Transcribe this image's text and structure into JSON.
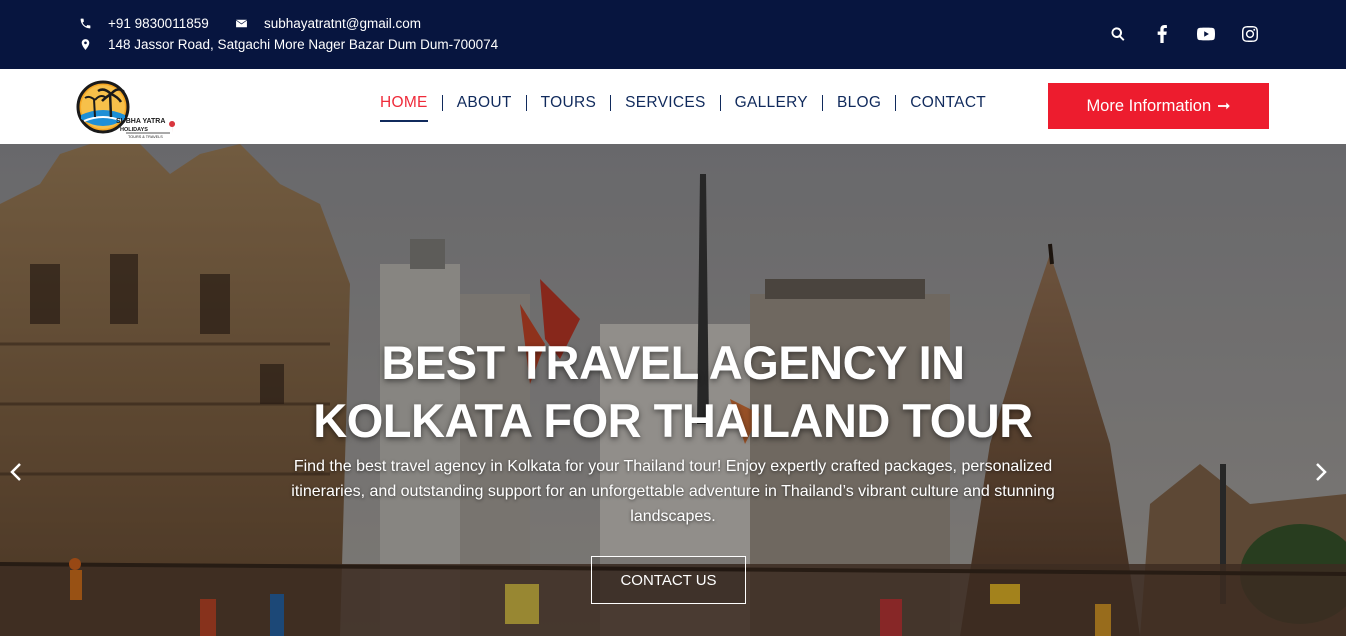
{
  "topbar": {
    "phone": "+91 9830011859",
    "email": "subhayatratnt@gmail.com",
    "address": "148 Jassor Road, Satgachi More Nager Bazar Dum Dum-700074",
    "icons": [
      "phone-icon",
      "envelope-icon",
      "map-marker-icon"
    ],
    "social": [
      "search-icon",
      "facebook-icon",
      "youtube-icon",
      "instagram-icon"
    ]
  },
  "header": {
    "logo": {
      "line1": "SUBHA YATRA",
      "line2": "HOLIDAYS",
      "line3": "TOURS & TRAVELS"
    },
    "nav": [
      {
        "label": "HOME",
        "active": true
      },
      {
        "label": "ABOUT",
        "active": false
      },
      {
        "label": "TOURS",
        "active": false
      },
      {
        "label": "SERVICES",
        "active": false
      },
      {
        "label": "GALLERY",
        "active": false
      },
      {
        "label": "BLOG",
        "active": false
      },
      {
        "label": "CONTACT",
        "active": false
      }
    ],
    "cta_label": "More Information",
    "cta_arrow": "➞"
  },
  "hero": {
    "title_line1": "BEST TRAVEL AGENCY IN",
    "title_line2": "KOLKATA FOR THAILAND TOUR",
    "description": "Find the best travel agency in Kolkata for your Thailand tour! Enjoy expertly crafted packages, personalized itineraries, and outstanding support for an unforgettable adventure in Thailand’s vibrant culture and stunning landscapes.",
    "button_label": "CONTACT US"
  },
  "colors": {
    "topbar_bg": "#07153f",
    "nav_text": "#102a5c",
    "accent_red": "#ed1c2e"
  }
}
